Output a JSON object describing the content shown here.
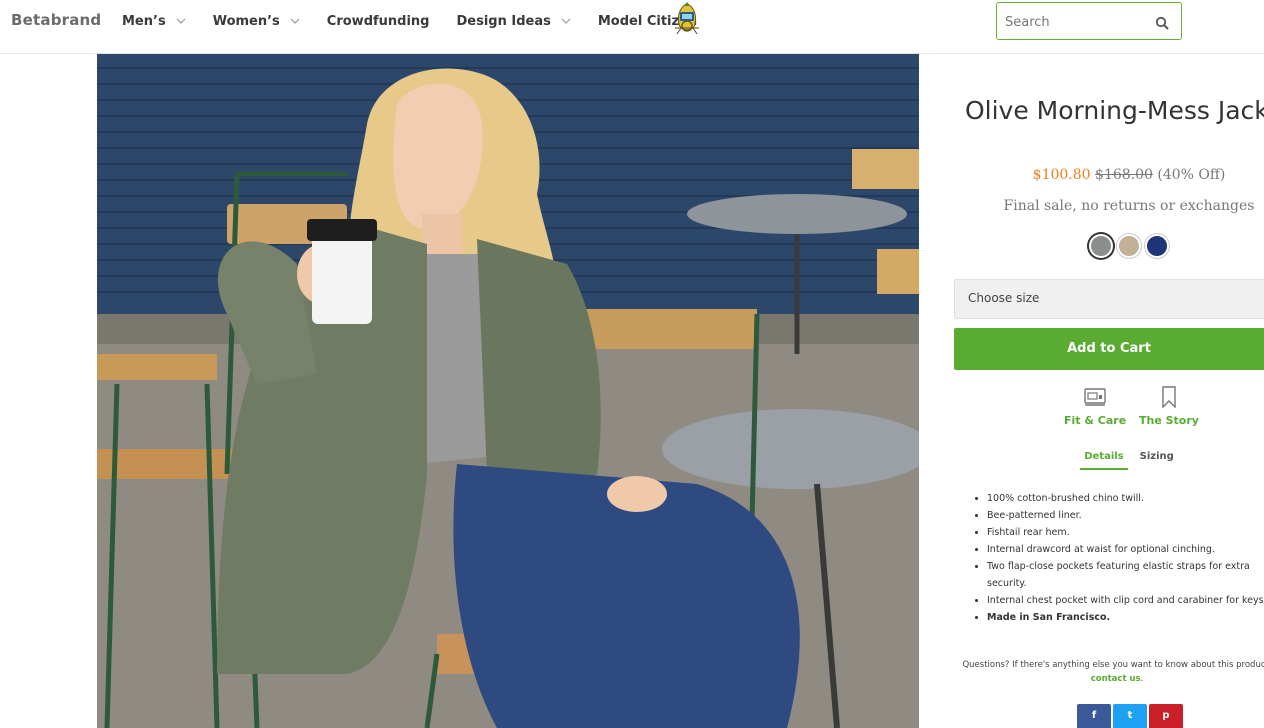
{
  "brand": {
    "logo_text": "Betabrand"
  },
  "nav": {
    "items": [
      {
        "label": "Men’s",
        "has_dropdown": true
      },
      {
        "label": "Women’s",
        "has_dropdown": true
      },
      {
        "label": "Crowdfunding",
        "has_dropdown": false
      },
      {
        "label": "Design Ideas",
        "has_dropdown": true
      },
      {
        "label": "Model Citizen",
        "has_dropdown": false
      }
    ]
  },
  "search": {
    "placeholder": "Search",
    "value": ""
  },
  "product": {
    "title": "Olive Morning-Mess Jacket",
    "sale_price": "$100.80",
    "original_price": "$168.00",
    "discount": "(40% Off)",
    "final_sale": "Final sale, no returns or exchanges",
    "swatches": [
      {
        "color": "#8a8f8c",
        "selected": true
      },
      {
        "color": "#c2b097",
        "selected": false
      },
      {
        "color": "#1e3478",
        "selected": false
      }
    ],
    "size_placeholder": "Choose size",
    "add_to_cart": "Add to Cart",
    "links": {
      "fit_care": "Fit & Care",
      "story": "The Story"
    },
    "tabs": {
      "details": "Details",
      "sizing": "Sizing"
    },
    "details": [
      "100% cotton-brushed chino twill.",
      "Bee-patterned liner.",
      "Fishtail rear hem.",
      "Internal drawcord at waist for optional cinching.",
      "Two flap-close pockets featuring elastic straps for extra security.",
      "Internal chest pocket with clip cord and carabiner for keys.",
      "Made in San Francisco."
    ],
    "questions_text": "Questions? If there's anything else you want to know about this product,",
    "contact_link": "contact us",
    "contact_suffix": "."
  },
  "social": {
    "facebook": "f",
    "twitter": "t",
    "pinterest": "p"
  },
  "colors": {
    "accent_green": "#5aab31",
    "sale_orange": "#f07d1c"
  }
}
